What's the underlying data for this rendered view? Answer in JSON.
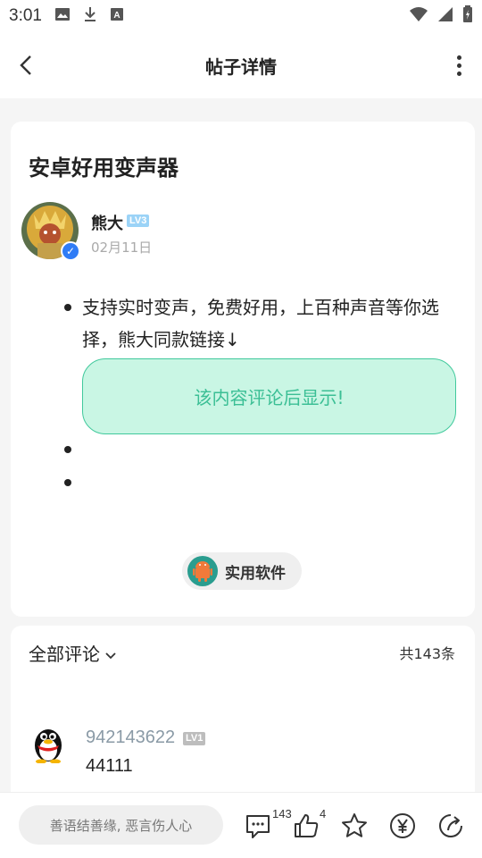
{
  "status_bar": {
    "time": "3:01",
    "icons": [
      "image-icon",
      "download-icon",
      "font-icon",
      "wifi-icon",
      "signal-icon",
      "battery-icon"
    ]
  },
  "header": {
    "title": "帖子详情",
    "back_icon": "chevron-left-icon",
    "more_icon": "more-vertical-icon"
  },
  "post": {
    "title": "安卓好用变声器",
    "author": {
      "name": "熊大",
      "level": "LV3",
      "date": "02月11日",
      "verified": true
    },
    "content": "支持实时变声，免费好用，上百种声音等你选择，熊大同款链接↓",
    "hidden_notice": "该内容评论后显示!",
    "tag": "实用软件"
  },
  "comments": {
    "filter_label": "全部评论",
    "count_label": "共143条",
    "items": [
      {
        "user": "942143622",
        "level": "LV1",
        "text": "44111"
      }
    ]
  },
  "bottom_bar": {
    "input_placeholder": "善语结善缘, 恶言伤人心",
    "comment_count": "143",
    "like_count": "4"
  },
  "colors": {
    "accent_green": "#3bbf95",
    "hidden_box_bg": "#c9f6e4",
    "verified_blue": "#2f7cf6"
  }
}
